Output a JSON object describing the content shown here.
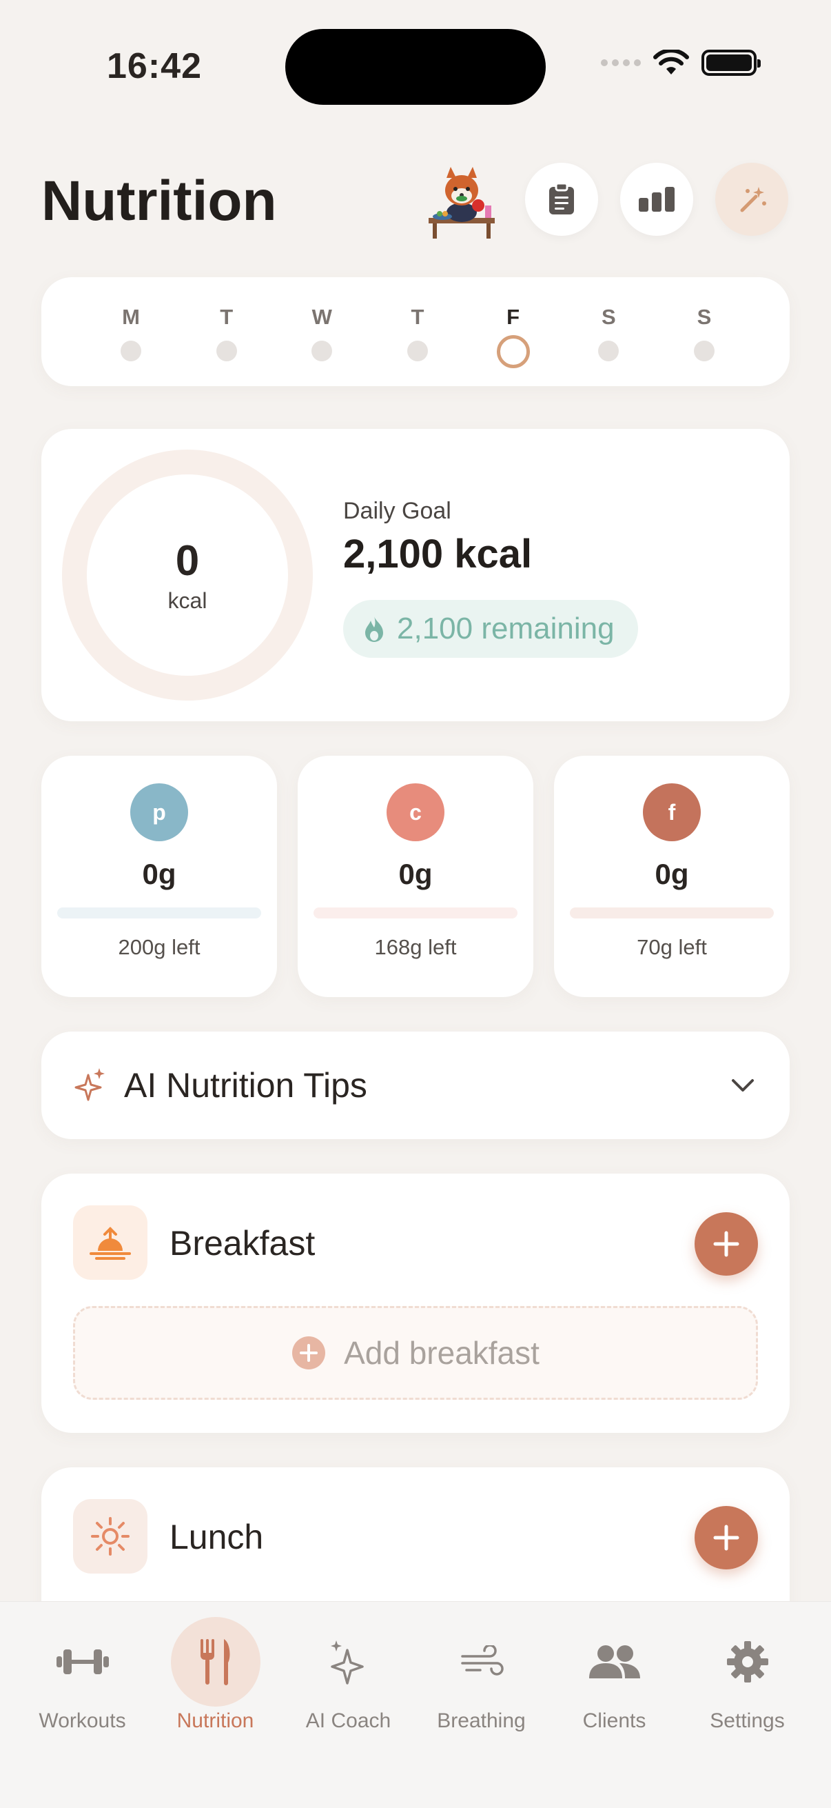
{
  "status": {
    "time": "16:42"
  },
  "header": {
    "title": "Nutrition"
  },
  "week": {
    "days": [
      {
        "label": "M",
        "active": false
      },
      {
        "label": "T",
        "active": false
      },
      {
        "label": "W",
        "active": false
      },
      {
        "label": "T",
        "active": false
      },
      {
        "label": "F",
        "active": true
      },
      {
        "label": "S",
        "active": false
      },
      {
        "label": "S",
        "active": false
      }
    ]
  },
  "goal": {
    "consumed": "0",
    "consumed_unit": "kcal",
    "label": "Daily Goal",
    "value": "2,100 kcal",
    "remaining": "2,100 remaining"
  },
  "macros": [
    {
      "letter": "p",
      "value": "0g",
      "left": "200g left",
      "color": "#89b7c8",
      "track": "#ecf3f6"
    },
    {
      "letter": "c",
      "value": "0g",
      "left": "168g left",
      "color": "#e78c7c",
      "track": "#fbeeec"
    },
    {
      "letter": "f",
      "value": "0g",
      "left": "70g left",
      "color": "#c4735c",
      "track": "#f8ece8"
    }
  ],
  "tips": {
    "title": "AI Nutrition Tips"
  },
  "meals": {
    "breakfast": {
      "title": "Breakfast",
      "add_label": "Add breakfast"
    },
    "lunch": {
      "title": "Lunch"
    }
  },
  "tabs": [
    {
      "label": "Workouts",
      "icon": "dumbbell-icon",
      "active": false
    },
    {
      "label": "Nutrition",
      "icon": "fork-knife-icon",
      "active": true
    },
    {
      "label": "AI Coach",
      "icon": "sparkles-icon",
      "active": false
    },
    {
      "label": "Breathing",
      "icon": "wind-icon",
      "active": false
    },
    {
      "label": "Clients",
      "icon": "people-icon",
      "active": false
    },
    {
      "label": "Settings",
      "icon": "gear-icon",
      "active": false
    }
  ],
  "colors": {
    "accent": "#c8775a",
    "teal": "#7bb5a6",
    "background": "#f5f2ef"
  }
}
